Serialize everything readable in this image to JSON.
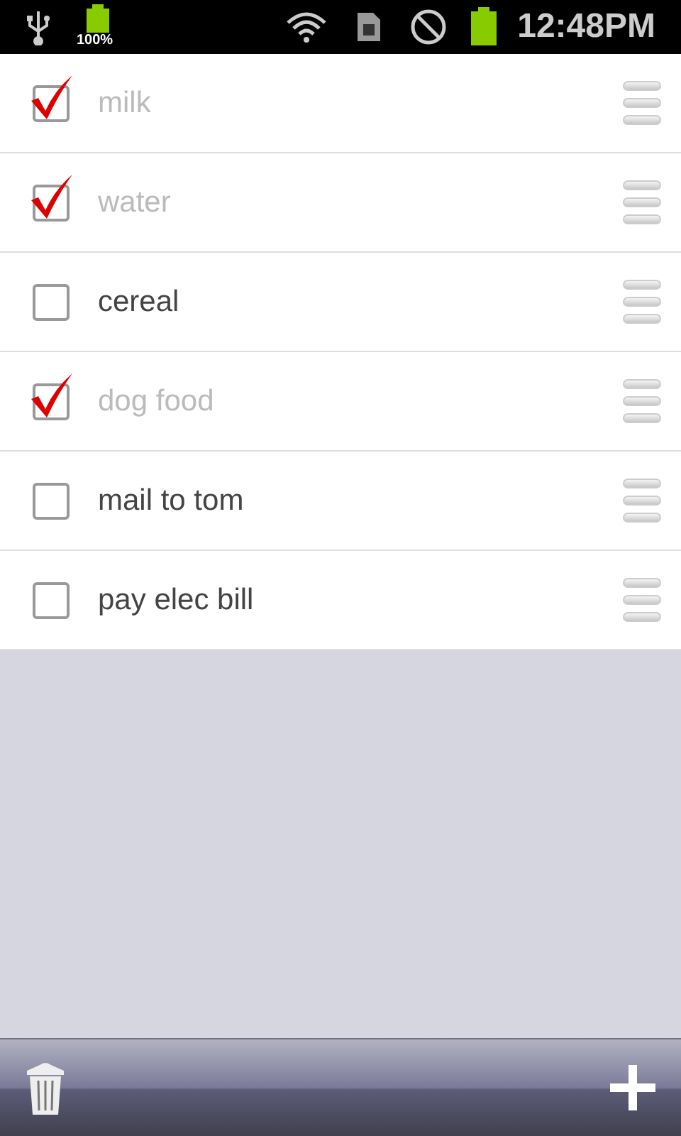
{
  "status_bar": {
    "battery_percent": "100%",
    "time": "12:48PM"
  },
  "items": [
    {
      "label": "milk",
      "checked": true
    },
    {
      "label": "water",
      "checked": true
    },
    {
      "label": "cereal",
      "checked": false
    },
    {
      "label": "dog food",
      "checked": true
    },
    {
      "label": "mail to tom",
      "checked": false
    },
    {
      "label": "pay elec bill",
      "checked": false
    }
  ]
}
